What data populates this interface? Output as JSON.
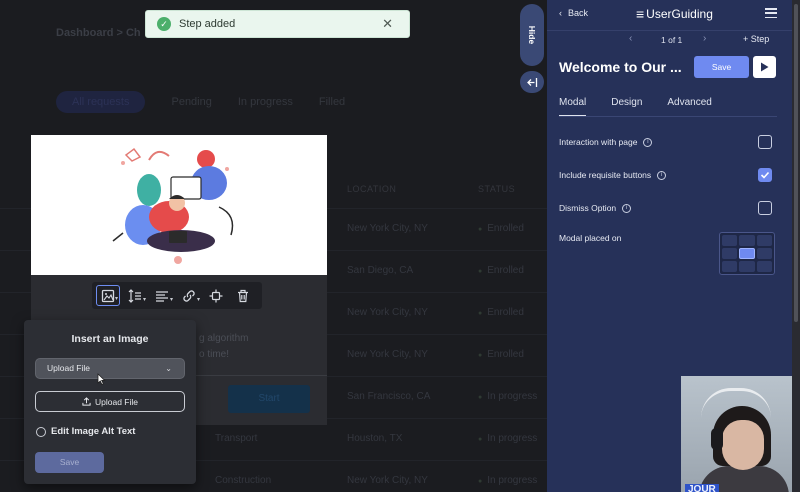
{
  "toast": {
    "message": "Step added"
  },
  "background": {
    "breadcrumb": "Dashboard > Ch",
    "tabs": [
      "All requests",
      "Pending",
      "In progress",
      "Filled"
    ],
    "columns": [
      "LOCATION",
      "STATUS"
    ],
    "rows": [
      {
        "location": "New York City, NY",
        "status": "Enrolled"
      },
      {
        "location": "San Diego, CA",
        "status": "Enrolled"
      },
      {
        "location": "New York City, NY",
        "status": "Enrolled"
      },
      {
        "location": "New York City, NY",
        "status": "Enrolled"
      },
      {
        "location": "San Francisco, CA",
        "status": "In progress",
        "name": ""
      },
      {
        "location": "Houston, TX",
        "status": "In progress",
        "name": "Transport"
      },
      {
        "location": "New York City, NY",
        "status": "In progress",
        "name": "Construction"
      }
    ]
  },
  "card": {
    "text_line1": "g algorithm",
    "text_line2": "o time!",
    "button_label": "Start"
  },
  "insert_image": {
    "title": "Insert an Image",
    "source_select": "Upload File",
    "upload_button": "Upload File",
    "alt_text_label": "Edit Image Alt Text",
    "save_label": "Save"
  },
  "hide_tab": "Hide",
  "panel": {
    "back_label": "Back",
    "brand": "UserGuiding",
    "page_indicator": "1 of 1",
    "add_step_label": "+ Step",
    "title": "Welcome to Our ...",
    "save_label": "Save",
    "tabs": [
      "Modal",
      "Design",
      "Advanced"
    ],
    "active_tab": "Modal",
    "options": [
      {
        "label": "Interaction with page",
        "checked": false
      },
      {
        "label": "Include requisite buttons",
        "checked": true
      },
      {
        "label": "Dismiss Option",
        "checked": false
      }
    ],
    "placement_label": "Modal placed on",
    "placement_selected": "center"
  },
  "webcam": {
    "badge": "JOUR"
  },
  "colors": {
    "panel_bg": "#263159",
    "accent": "#6f8af0",
    "toast_bg": "#eaf6ee",
    "toast_icon": "#4caf6b"
  }
}
